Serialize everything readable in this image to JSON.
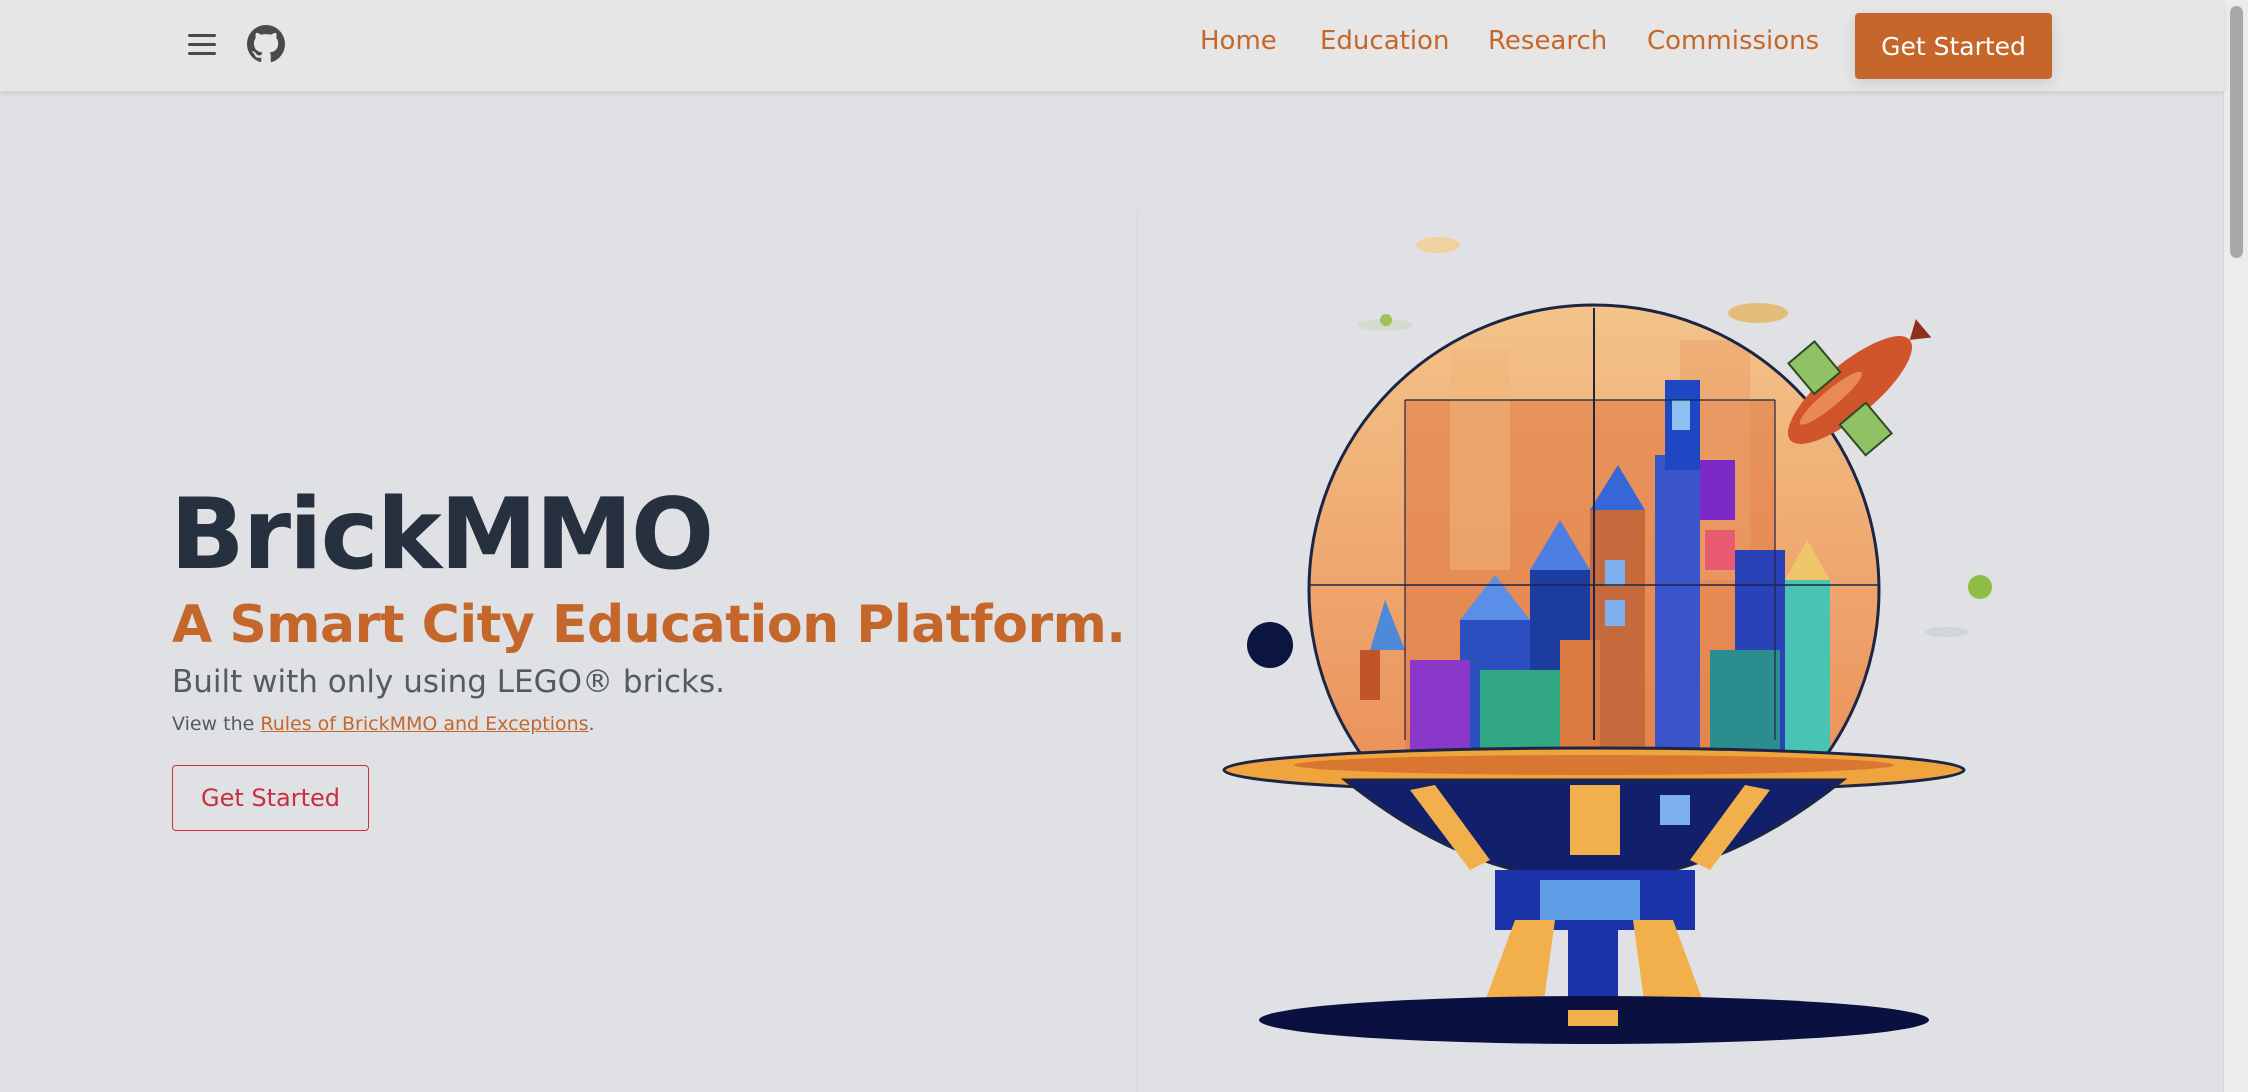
{
  "header": {
    "menu_icon": "hamburger-menu-icon",
    "github_icon": "github-icon",
    "nav": [
      "Home",
      "Education",
      "Research",
      "Commissions"
    ],
    "cta_label": "Get Started"
  },
  "hero": {
    "title": "BrickMMO",
    "subtitle": "A Smart City Education Platform.",
    "description": "Built with only using LEGO® bricks.",
    "rules_prefix": "View the ",
    "rules_link": "Rules of BrickMMO and Exceptions",
    "rules_suffix": ".",
    "button_label": "Get Started"
  },
  "colors": {
    "accent": "#c5672a",
    "title": "#27303f",
    "button_outline": "#c9303f",
    "background": "#dfe1e5"
  }
}
